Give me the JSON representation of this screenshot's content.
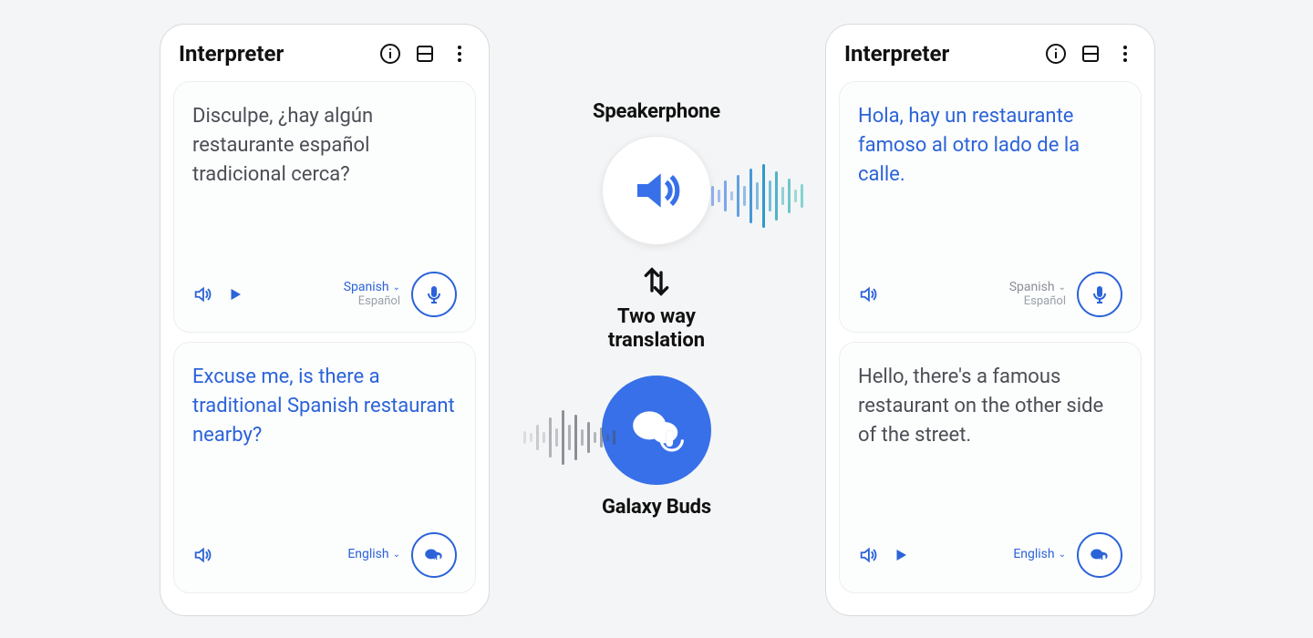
{
  "phones": {
    "left": {
      "title": "Interpreter",
      "top_card": {
        "text": "Disculpe, ¿hay algún restaurante español tradicional cerca?",
        "lang_primary": "Spanish",
        "lang_secondary": "Español",
        "show_play": true,
        "lang_gray": false
      },
      "bottom_card": {
        "text": "Excuse me, is there a traditional Spanish restaurant nearby?",
        "lang_primary": "English",
        "show_play": false,
        "mic_style": "buds"
      }
    },
    "right": {
      "title": "Interpreter",
      "top_card": {
        "text": "Hola, hay un restaurante famoso al otro lado de la calle.",
        "lang_primary": "Spanish",
        "lang_secondary": "Español",
        "show_play": false,
        "lang_gray": true
      },
      "bottom_card": {
        "text": "Hello, there's a famous restaurant on the other side of the street.",
        "lang_primary": "English",
        "show_play": true,
        "mic_style": "buds"
      }
    }
  },
  "center": {
    "speakerphone_label": "Speakerphone",
    "two_way_label_1": "Two way",
    "two_way_label_2": "translation",
    "buds_label": "Galaxy Buds"
  },
  "colors": {
    "accent": "#2b63d9",
    "teal": "#2db9b0",
    "gray": "#8a8f97"
  },
  "waves": {
    "teal_heights": [
      22,
      14,
      34,
      10,
      46,
      22,
      60,
      30,
      70,
      34,
      54,
      20,
      38,
      14,
      26
    ],
    "gray_heights": [
      14,
      10,
      28,
      12,
      44,
      20,
      60,
      28,
      50,
      18,
      34,
      12,
      22,
      8,
      16
    ]
  }
}
